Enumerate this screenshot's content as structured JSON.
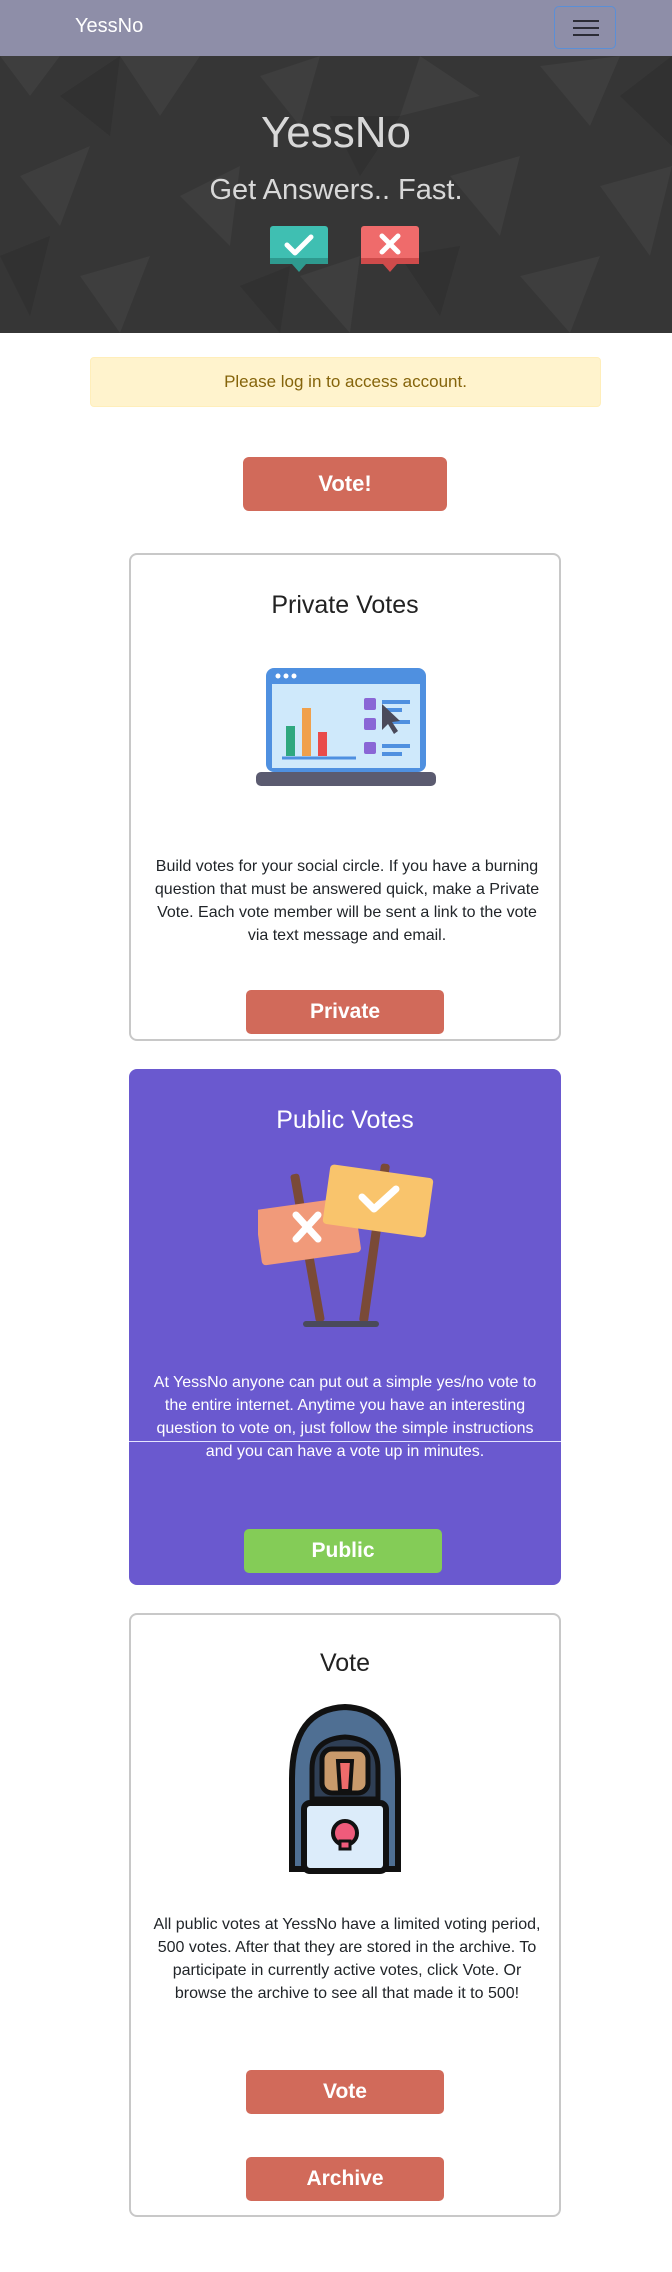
{
  "navbar": {
    "brand": "YessNo",
    "toggle_icon": "hamburger-menu-icon"
  },
  "hero": {
    "title": "YessNo",
    "subtitle": "Get Answers.. Fast.",
    "icons": [
      "check-speech-bubble-icon",
      "x-speech-bubble-icon"
    ],
    "colors": {
      "background": "#363636",
      "check": "#3fbfb2",
      "cross": "#ef6b6b"
    }
  },
  "alert": {
    "message": "Please log in to access account."
  },
  "main_button": {
    "label": "Vote!"
  },
  "cards": {
    "private": {
      "title": "Private Votes",
      "illustration": "laptop-chart-icon",
      "text": "Build votes for your social circle. If you have a burning question that must be answered quick, make a Private Vote. Each vote member will be sent a link to the vote via text message and email.",
      "button": "Private"
    },
    "public": {
      "title": "Public Votes",
      "illustration": "yes-no-signs-icon",
      "text": "At YessNo anyone can put out a simple yes/no vote to the entire internet. Anytime you have an interesting question to vote on, just follow the simple instructions and you can have a vote up in minutes.",
      "button": "Public",
      "colors": {
        "background": "#6a59cf",
        "button": "#84cc57"
      }
    },
    "vote": {
      "title": "Vote",
      "illustration": "hooded-hacker-laptop-icon",
      "text": "All public votes at YessNo have a limited voting period, 500 votes. After that they are stored in the archive. To participate in currently active votes, click Vote. Or browse the archive to see all that made it to 500!",
      "buttons": [
        "Vote",
        "Archive"
      ]
    }
  },
  "colors": {
    "navbar": "#8e8ea8",
    "primary_button": "#d16a5a",
    "alert_bg": "#fff3cd",
    "alert_text": "#85640b"
  }
}
